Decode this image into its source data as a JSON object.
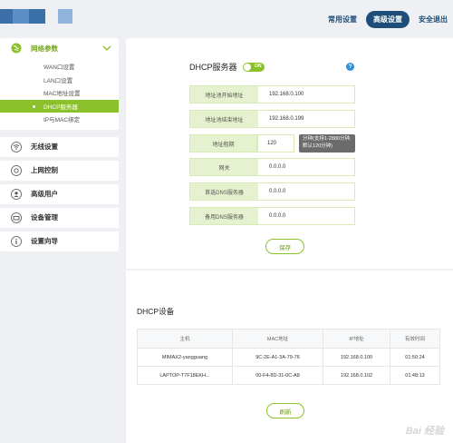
{
  "topnav": {
    "common_settings": "常用设置",
    "advanced_settings": "高级设置",
    "logout": "安全退出"
  },
  "sidebar": {
    "network": {
      "label": "网络参数",
      "items": [
        "WAN口设置",
        "LAN口设置",
        "MAC地址设置",
        "DHCP服务器",
        "IP与MAC绑定"
      ]
    },
    "wireless": "无线设置",
    "access_control": "上网控制",
    "advanced_users": "高级用户",
    "device_mgmt": "设备管理",
    "wizard": "设置向导"
  },
  "dhcp": {
    "title": "DHCP服务器",
    "toggle_label": "ON",
    "help": "?",
    "fields": [
      {
        "label": "地址池开始地址",
        "value": "192.168.0.100"
      },
      {
        "label": "地址池结束地址",
        "value": "192.168.0.199"
      },
      {
        "label": "地址租期",
        "value": "120"
      },
      {
        "label": "网关",
        "value": "0.0.0.0"
      },
      {
        "label": "首选DNS服务器",
        "value": "0.0.0.0"
      },
      {
        "label": "备用DNS服务器",
        "value": "0.0.0.0"
      }
    ],
    "lease_tip": "分钟(支持1-2880分钟,默认120分钟)",
    "save_label": "保存"
  },
  "devices": {
    "title": "DHCP设备",
    "columns": [
      "主机",
      "MAC地址",
      "IP地址",
      "有效时间"
    ],
    "rows": [
      [
        "MIMAX2-yangguang",
        "9C-2E-A1-3A-79-76",
        "192.168.0.100",
        "01:50:24"
      ],
      [
        "LAPTOP-T7F18EKH...",
        "00-F4-8D-31-0C-A8",
        "192.168.0.102",
        "01:48:13"
      ]
    ],
    "refresh_label": "刷新"
  },
  "colors": {
    "accent_green": "#8bc12a",
    "nav_blue": "#1d4e7a",
    "field_label_bg": "#e6f2cf"
  },
  "watermark": "Bai 经验"
}
